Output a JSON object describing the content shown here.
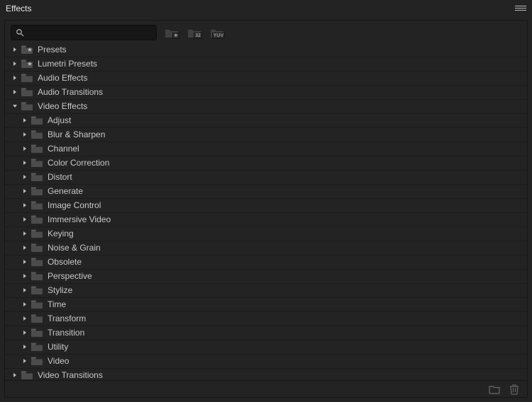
{
  "panel_title": "Effects",
  "search_value": "",
  "toolbar_badges": [
    "★",
    "32",
    "YUV"
  ],
  "tree": [
    {
      "indent": 0,
      "expanded": false,
      "star": true,
      "label": "Presets"
    },
    {
      "indent": 0,
      "expanded": false,
      "star": true,
      "label": "Lumetri Presets"
    },
    {
      "indent": 0,
      "expanded": false,
      "star": false,
      "label": "Audio Effects"
    },
    {
      "indent": 0,
      "expanded": false,
      "star": false,
      "label": "Audio Transitions"
    },
    {
      "indent": 0,
      "expanded": true,
      "star": false,
      "label": "Video Effects"
    },
    {
      "indent": 1,
      "expanded": false,
      "star": false,
      "label": "Adjust"
    },
    {
      "indent": 1,
      "expanded": false,
      "star": false,
      "label": "Blur & Sharpen"
    },
    {
      "indent": 1,
      "expanded": false,
      "star": false,
      "label": "Channel"
    },
    {
      "indent": 1,
      "expanded": false,
      "star": false,
      "label": "Color Correction"
    },
    {
      "indent": 1,
      "expanded": false,
      "star": false,
      "label": "Distort"
    },
    {
      "indent": 1,
      "expanded": false,
      "star": false,
      "label": "Generate"
    },
    {
      "indent": 1,
      "expanded": false,
      "star": false,
      "label": "Image Control"
    },
    {
      "indent": 1,
      "expanded": false,
      "star": false,
      "label": "Immersive Video"
    },
    {
      "indent": 1,
      "expanded": false,
      "star": false,
      "label": "Keying"
    },
    {
      "indent": 1,
      "expanded": false,
      "star": false,
      "label": "Noise & Grain"
    },
    {
      "indent": 1,
      "expanded": false,
      "star": false,
      "label": "Obsolete"
    },
    {
      "indent": 1,
      "expanded": false,
      "star": false,
      "label": "Perspective"
    },
    {
      "indent": 1,
      "expanded": false,
      "star": false,
      "label": "Stylize"
    },
    {
      "indent": 1,
      "expanded": false,
      "star": false,
      "label": "Time"
    },
    {
      "indent": 1,
      "expanded": false,
      "star": false,
      "label": "Transform"
    },
    {
      "indent": 1,
      "expanded": false,
      "star": false,
      "label": "Transition"
    },
    {
      "indent": 1,
      "expanded": false,
      "star": false,
      "label": "Utility"
    },
    {
      "indent": 1,
      "expanded": false,
      "star": false,
      "label": "Video"
    },
    {
      "indent": 0,
      "expanded": false,
      "star": false,
      "label": "Video Transitions"
    }
  ]
}
